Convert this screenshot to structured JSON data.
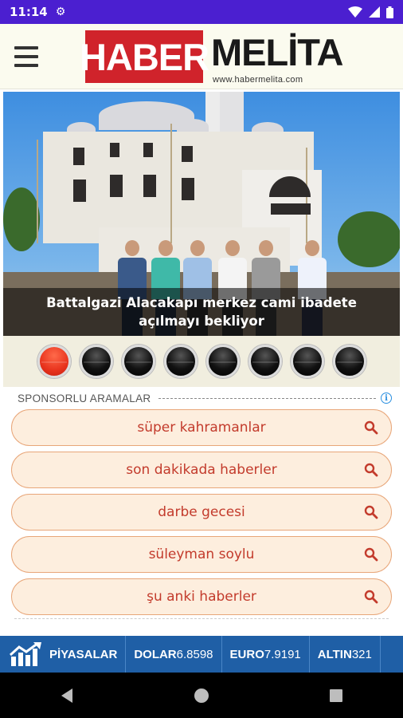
{
  "status_bar": {
    "time": "11:14",
    "icons": [
      "gear-icon",
      "wifi-icon",
      "signal-icon",
      "battery-icon"
    ]
  },
  "header": {
    "logo": {
      "brand_red": "HABER",
      "brand_black": "MELİTA",
      "url": "www.habermelita.com"
    },
    "menu_icon": "hamburger-icon"
  },
  "slider": {
    "caption": "Battalgazi Alacakapı merkez cami ibadete açılmayı bekliyor",
    "dots_total": 8,
    "active_index": 0
  },
  "sponsored": {
    "title": "SPONSORLU ARAMALAR",
    "items": [
      {
        "label": "süper kahramanlar"
      },
      {
        "label": "son dakikada haberler"
      },
      {
        "label": "darbe gecesi"
      },
      {
        "label": "süleyman soylu"
      },
      {
        "label": "şu anki haberler"
      }
    ]
  },
  "ticker": {
    "market_label": "PİYASALAR",
    "items": [
      {
        "name": "DOLAR",
        "value": "6.8598"
      },
      {
        "name": "EURO",
        "value": "7.9191"
      },
      {
        "name": "ALTIN",
        "value": "321"
      }
    ]
  },
  "colors": {
    "status_bar": "#4b1fd0",
    "logo_red": "#d0232b",
    "pill_text": "#c33b2c",
    "ticker_bg": "#1f5fa6"
  }
}
